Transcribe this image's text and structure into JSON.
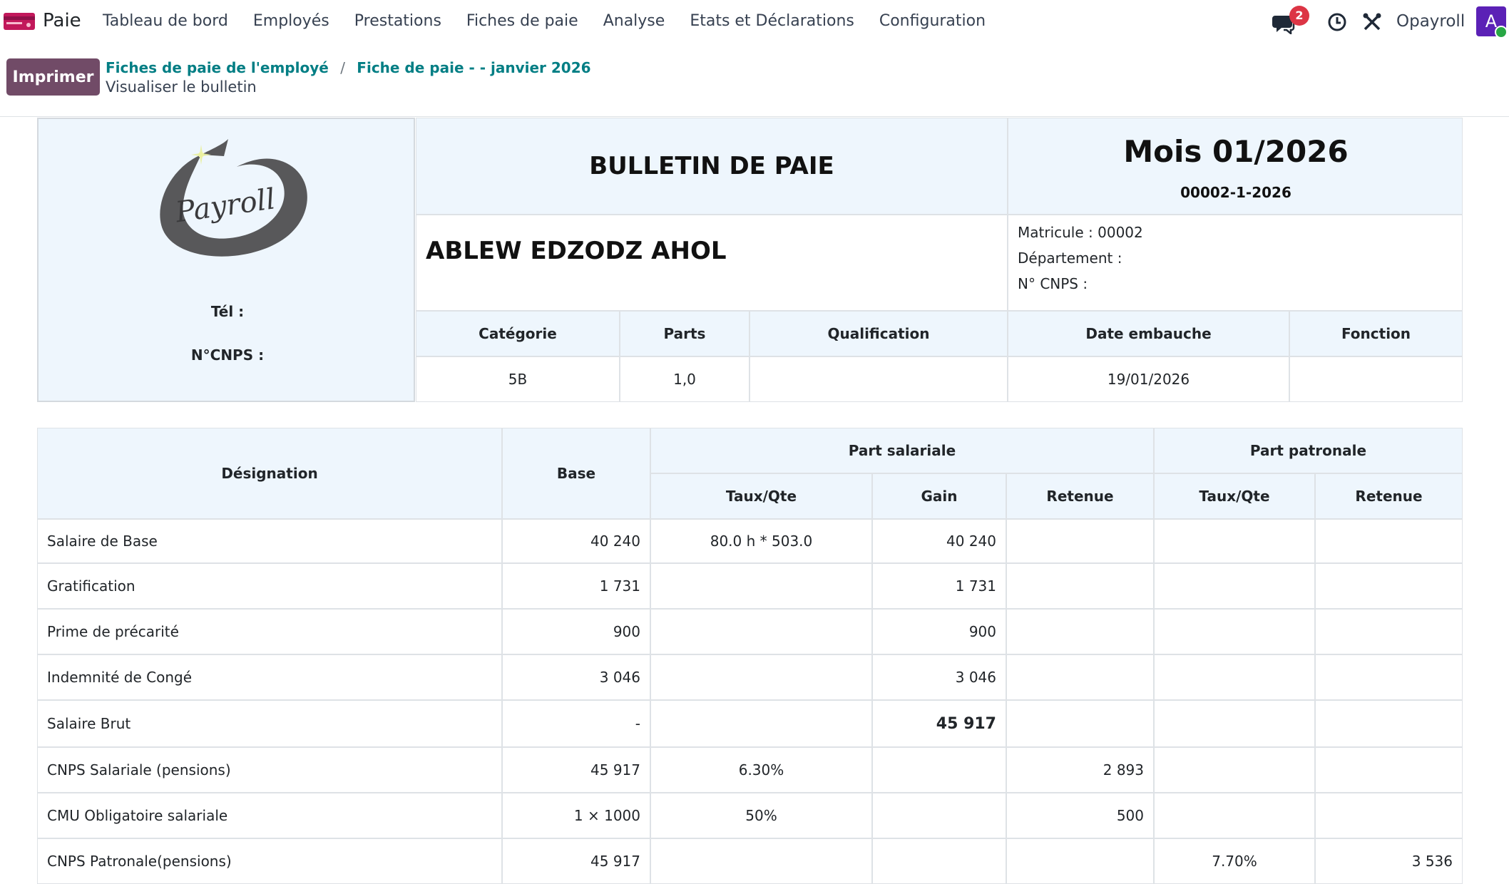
{
  "nav": {
    "app_name": "Paie",
    "menu": [
      "Tableau de bord",
      "Employés",
      "Prestations",
      "Fiches de paie",
      "Analyse",
      "Etats et Déclarations",
      "Configuration"
    ],
    "chat_badge": "2",
    "company": "Opayroll",
    "avatar_letter": "A"
  },
  "control": {
    "print_label": "Imprimer",
    "breadcrumb": [
      "Fiches de paie de l'employé",
      "Fiche de paie - - janvier 2026"
    ],
    "separator": "/",
    "subtitle": "Visualiser le bulletin"
  },
  "header": {
    "logo_text": "Payroll",
    "tel_label": "Tél :",
    "cnps_label": "N°CNPS :",
    "title": "BULLETIN DE PAIE",
    "month": "Mois 01/2026",
    "reference": "00002-1-2026",
    "employee_name": "ABLEW EDZODZ AHOL",
    "matricule": "Matricule : 00002",
    "departement": "Département :",
    "n_cnps": "N° CNPS :",
    "columns": [
      "Catégorie",
      "Parts",
      "Qualification",
      "Date embauche",
      "Fonction"
    ],
    "values": [
      "5B",
      "1,0",
      "",
      "19/01/2026",
      ""
    ]
  },
  "table": {
    "col_designation": "Désignation",
    "col_base": "Base",
    "group_salariale": "Part salariale",
    "group_patronale": "Part patronale",
    "col_taux_sal": "Taux/Qte",
    "col_gain": "Gain",
    "col_retenue_sal": "Retenue",
    "col_taux_pat": "Taux/Qte",
    "col_retenue_pat": "Retenue",
    "rows": [
      {
        "designation": "Salaire de Base",
        "base": "40 240",
        "taux": "80.0 h * 503.0",
        "gain": "40 240",
        "retenue": "",
        "taux_pat": "",
        "retenue_pat": ""
      },
      {
        "designation": "Gratification",
        "base": "1 731",
        "taux": "",
        "gain": "1 731",
        "retenue": "",
        "taux_pat": "",
        "retenue_pat": ""
      },
      {
        "designation": "Prime de précarité",
        "base": "900",
        "taux": "",
        "gain": "900",
        "retenue": "",
        "taux_pat": "",
        "retenue_pat": ""
      },
      {
        "designation": "Indemnité de Congé",
        "base": "3 046",
        "taux": "",
        "gain": "3 046",
        "retenue": "",
        "taux_pat": "",
        "retenue_pat": ""
      },
      {
        "designation": "Salaire Brut",
        "base": "-",
        "taux": "",
        "gain": "45 917",
        "retenue": "",
        "taux_pat": "",
        "retenue_pat": ""
      },
      {
        "designation": "CNPS Salariale (pensions)",
        "base": "45 917",
        "taux": "6.30%",
        "gain": "",
        "retenue": "2 893",
        "taux_pat": "",
        "retenue_pat": ""
      },
      {
        "designation": "CMU Obligatoire salariale",
        "base": "1 × 1000",
        "taux": "50%",
        "gain": "",
        "retenue": "500",
        "taux_pat": "",
        "retenue_pat": ""
      },
      {
        "designation": "CNPS Patronale(pensions)",
        "base": "45 917",
        "taux": "",
        "gain": "",
        "retenue": "",
        "taux_pat": "7.70%",
        "retenue_pat": "3 536"
      }
    ]
  }
}
